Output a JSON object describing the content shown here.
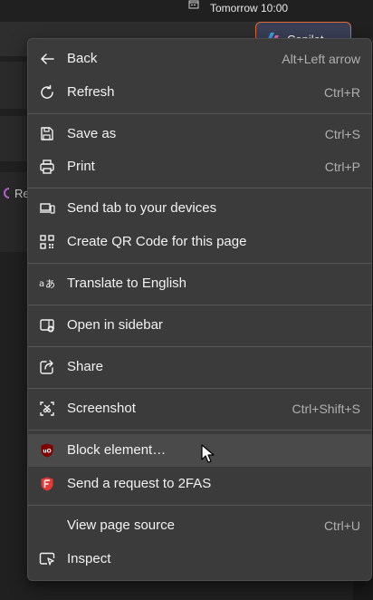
{
  "background": {
    "taskbar_time": "Tomorrow 10:00",
    "copilot_label": "Copilot",
    "partial_text": "Re"
  },
  "menu": {
    "items": [
      {
        "id": "back",
        "label": "Back",
        "shortcut": "Alt+Left arrow",
        "icon": "arrow-left-icon"
      },
      {
        "id": "refresh",
        "label": "Refresh",
        "shortcut": "Ctrl+R",
        "icon": "refresh-icon"
      },
      {
        "id": "save-as",
        "label": "Save as",
        "shortcut": "Ctrl+S",
        "icon": "save-icon"
      },
      {
        "id": "print",
        "label": "Print",
        "shortcut": "Ctrl+P",
        "icon": "printer-icon"
      },
      {
        "id": "send-tab",
        "label": "Send tab to your devices",
        "shortcut": "",
        "icon": "devices-icon"
      },
      {
        "id": "qr-code",
        "label": "Create QR Code for this page",
        "shortcut": "",
        "icon": "qr-code-icon"
      },
      {
        "id": "translate",
        "label": "Translate to English",
        "shortcut": "",
        "icon": "translate-icon"
      },
      {
        "id": "open-sidebar",
        "label": "Open in sidebar",
        "shortcut": "",
        "icon": "sidebar-icon"
      },
      {
        "id": "share",
        "label": "Share",
        "shortcut": "",
        "icon": "share-icon"
      },
      {
        "id": "screenshot",
        "label": "Screenshot",
        "shortcut": "Ctrl+Shift+S",
        "icon": "screenshot-icon"
      },
      {
        "id": "block-element",
        "label": "Block element…",
        "shortcut": "",
        "icon": "ublock-origin-icon",
        "hovered": true
      },
      {
        "id": "send-2fas",
        "label": "Send a request to 2FAS",
        "shortcut": "",
        "icon": "2fas-icon"
      },
      {
        "id": "view-source",
        "label": "View page source",
        "shortcut": "Ctrl+U",
        "icon": ""
      },
      {
        "id": "inspect",
        "label": "Inspect",
        "shortcut": "",
        "icon": "inspect-icon"
      }
    ]
  },
  "colors": {
    "menu_bg": "#3b3b3b",
    "hover_bg": "#4a4a4a",
    "text": "#f2f2f2",
    "shortcut_text": "#b0b0b0",
    "ublock_red": "#800000",
    "twofas_red": "#e53935"
  }
}
